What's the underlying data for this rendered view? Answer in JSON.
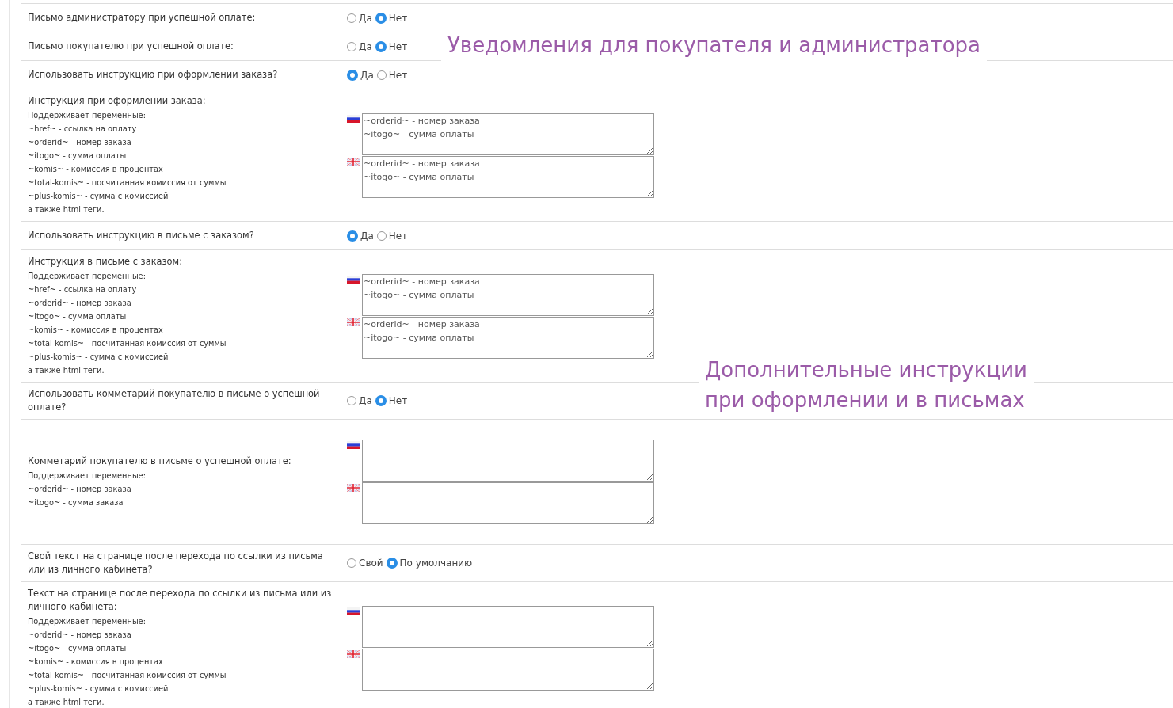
{
  "rows": [
    {
      "kind": "radio",
      "label": "Письмо администратору при успешной оплате:",
      "options": [
        {
          "label": "Да",
          "selected": false
        },
        {
          "label": "Нет",
          "selected": true
        }
      ]
    },
    {
      "kind": "radio",
      "label": "Письмо покупателю при успешной оплате:",
      "options": [
        {
          "label": "Да",
          "selected": false
        },
        {
          "label": "Нет",
          "selected": true
        }
      ]
    },
    {
      "kind": "radio",
      "label": "Использовать инструкцию при оформлении заказа?",
      "options": [
        {
          "label": "Да",
          "selected": true
        },
        {
          "label": "Нет",
          "selected": false
        }
      ]
    },
    {
      "kind": "text",
      "label": "Инструкция при оформлении заказа:",
      "hints": [
        "Поддерживает переменные:",
        "~href~ - ссылка на оплату",
        "~orderid~ - номер заказа",
        "~itogo~ - сумма оплаты",
        "~komis~ - комиссия в процентах",
        "~total-komis~ - посчитанная комиссия от суммы",
        "~plus-komis~ - сумма с комиссией",
        "а также html теги."
      ],
      "fields": [
        {
          "kind": "russia",
          "value": "~orderid~ - номер заказа\n~itogo~ - сумма оплаты"
        },
        {
          "kind": "britain",
          "value": "~orderid~ - номер заказа\n~itogo~ - сумма оплаты"
        }
      ]
    },
    {
      "kind": "radio",
      "label": "Использовать инструкцию в письме с заказом?",
      "options": [
        {
          "label": "Да",
          "selected": true
        },
        {
          "label": "Нет",
          "selected": false
        }
      ]
    },
    {
      "kind": "text",
      "label": "Инструкция в письме с заказом:",
      "hints": [
        "Поддерживает переменные:",
        "~href~ - ссылка на оплату",
        "~orderid~ - номер заказа",
        "~itogo~ - сумма оплаты",
        "~komis~ - комиссия в процентах",
        "~total-komis~ - посчитанная комиссия от суммы",
        "~plus-komis~ - сумма с комиссией",
        "а также html теги."
      ],
      "fields": [
        {
          "kind": "russia",
          "value": "~orderid~ - номер заказа\n~itogo~ - сумма оплаты"
        },
        {
          "kind": "britain",
          "value": "~orderid~ - номер заказа\n~itogo~ - сумма оплаты"
        }
      ]
    },
    {
      "kind": "radio",
      "label": "Использовать комметарий покупателю в письме о успешной оплате?",
      "options": [
        {
          "label": "Да",
          "selected": false
        },
        {
          "label": "Нет",
          "selected": true
        }
      ]
    },
    {
      "kind": "text",
      "label": "Комметарий покупателю в письме о успешной оплате:",
      "hints": [
        "Поддерживает переменные:",
        "~orderid~ - номер заказа",
        "~itogo~ - сумма заказа"
      ],
      "fields": [
        {
          "kind": "russia"
        },
        {
          "kind": "britain"
        }
      ]
    },
    {
      "kind": "radio",
      "label": "Свой текст на странице после перехода по ссылки из письма или из личного кабинета?",
      "options": [
        {
          "label": "Свой",
          "selected": false
        },
        {
          "label": "По умолчанию",
          "selected": true
        }
      ]
    },
    {
      "kind": "text",
      "label": "Текст на странице после перехода по ссылки из письма или из личного кабинета:",
      "hints": [
        "Поддерживает переменные:",
        "~orderid~ - номер заказа",
        "~itogo~ - сумма оплаты",
        "~komis~ - комиссия в процентах",
        "~total-komis~ - посчитанная комиссия от суммы",
        "~plus-komis~ - сумма с комиссией",
        "а также html теги."
      ],
      "fields": [
        {
          "kind": "russia"
        },
        {
          "kind": "britain"
        }
      ]
    }
  ],
  "annotations": [
    {
      "lines": [
        "Уведомления для покупателя и администратора"
      ]
    },
    {
      "lines": [
        "Дополнительные инструкции",
        "при оформлении и в письмах"
      ]
    }
  ]
}
